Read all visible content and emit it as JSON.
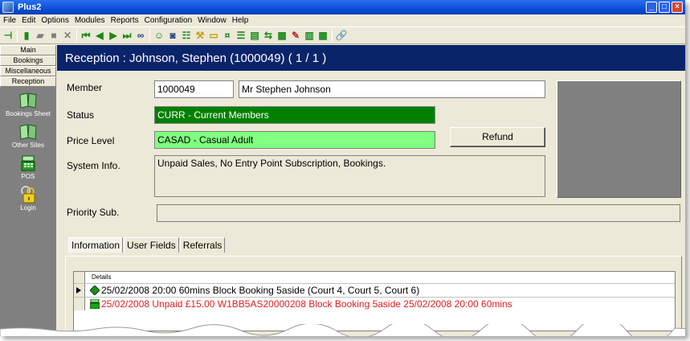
{
  "window": {
    "title": "Plus2",
    "controls": [
      "minimize",
      "maximize",
      "close"
    ]
  },
  "menu": [
    "File",
    "Edit",
    "Options",
    "Modules",
    "Reports",
    "Configuration",
    "Window",
    "Help"
  ],
  "toolbar_icons": [
    "first-record-icon",
    "new-icon",
    "open-icon",
    "stop-icon",
    "cancel-icon",
    "first-icon",
    "prev-icon",
    "next-icon",
    "last-icon",
    "binoculars-icon",
    "member-icon",
    "camera-icon",
    "group-icon",
    "tools-icon",
    "card-icon",
    "money-icon",
    "list-icon",
    "document-icon",
    "transfer-icon",
    "calendar-icon",
    "pen-icon",
    "chart-icon",
    "stats-icon",
    "link-icon"
  ],
  "leftnav": {
    "tabs": [
      "Main",
      "Bookings",
      "Miscellaneous",
      "Reception"
    ],
    "items": [
      {
        "label": "Bookings Sheet",
        "icon": "book-icon"
      },
      {
        "label": "Other Sites",
        "icon": "book-icon"
      },
      {
        "label": "POS",
        "icon": "cash-register-icon"
      },
      {
        "label": "Login",
        "icon": "keys-icon"
      }
    ]
  },
  "header": {
    "title": "Reception : Johnson, Stephen (1000049)  ( 1 / 1 )"
  },
  "form": {
    "member_label": "Member",
    "member_id": "1000049",
    "member_name": "Mr Stephen Johnson",
    "status_label": "Status",
    "status_value": "CURR - Current Members",
    "price_label": "Price Level",
    "price_value": "CASAD - Casual Adult",
    "refund_button": "Refund",
    "sysinfo_label": "System Info.",
    "sysinfo_value": "Unpaid Sales, No Entry Point Subscription, Bookings.",
    "priority_label": "Priority Sub.",
    "priority_value": ""
  },
  "tabs": [
    "Information",
    "User Fields",
    "Referrals"
  ],
  "grid": {
    "header": "Details",
    "rows": [
      {
        "text": "25/02/2008 20:00 60mins Block Booking 5aside (Court 4, Court 5, Court 6)",
        "color": "#000000",
        "icon": "booking-icon"
      },
      {
        "text": "25/02/2008 Unpaid £15.00 W1BB5AS20000208 Block Booking 5aside 25/02/2008 20:00 60mins",
        "color": "#e02020",
        "icon": "unpaid-icon"
      }
    ]
  },
  "colors": {
    "header_bg": "#0a246a",
    "status_bg": "#008000",
    "price_bg": "#80ff80",
    "nav_bg": "#808080"
  }
}
